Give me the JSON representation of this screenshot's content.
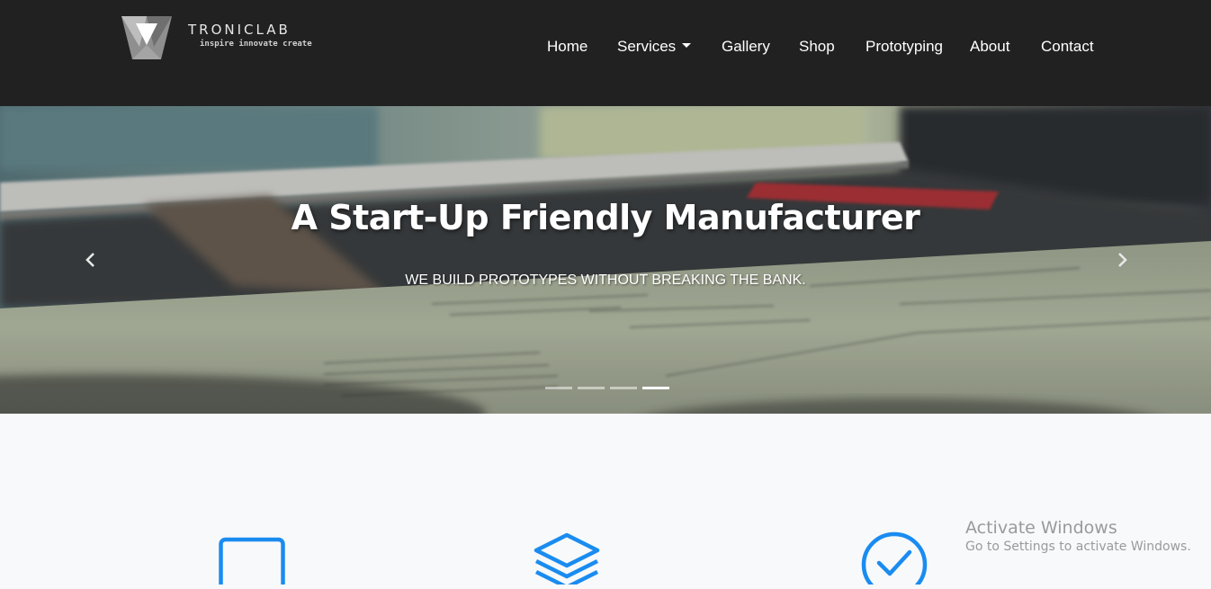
{
  "brand": {
    "name": "TRONICLAB",
    "tagline": "inspire innovate create"
  },
  "nav": {
    "items": [
      {
        "label": "Home"
      },
      {
        "label": "Services",
        "has_dropdown": true
      },
      {
        "label": "Gallery"
      },
      {
        "label": "Shop"
      },
      {
        "label": "Prototyping"
      },
      {
        "label": "About"
      },
      {
        "label": "Contact"
      }
    ]
  },
  "carousel": {
    "title": "A Start-Up Friendly Manufacturer",
    "subtitle": "WE BUILD PROTOTYPES WITHOUT BREAKING THE BANK.",
    "indicator_count": 4,
    "active_indicator": 4
  },
  "features": {
    "icons": [
      "monitor-icon",
      "layers-icon",
      "check-circle-icon"
    ],
    "accent_color": "#1a8cf0"
  },
  "system_overlay": {
    "title": "Activate Windows",
    "subtitle": "Go to Settings to activate Windows."
  },
  "colors": {
    "navbar_bg": "#212121",
    "page_bg": "#f8f9fa",
    "nav_text": "#ffffff"
  }
}
